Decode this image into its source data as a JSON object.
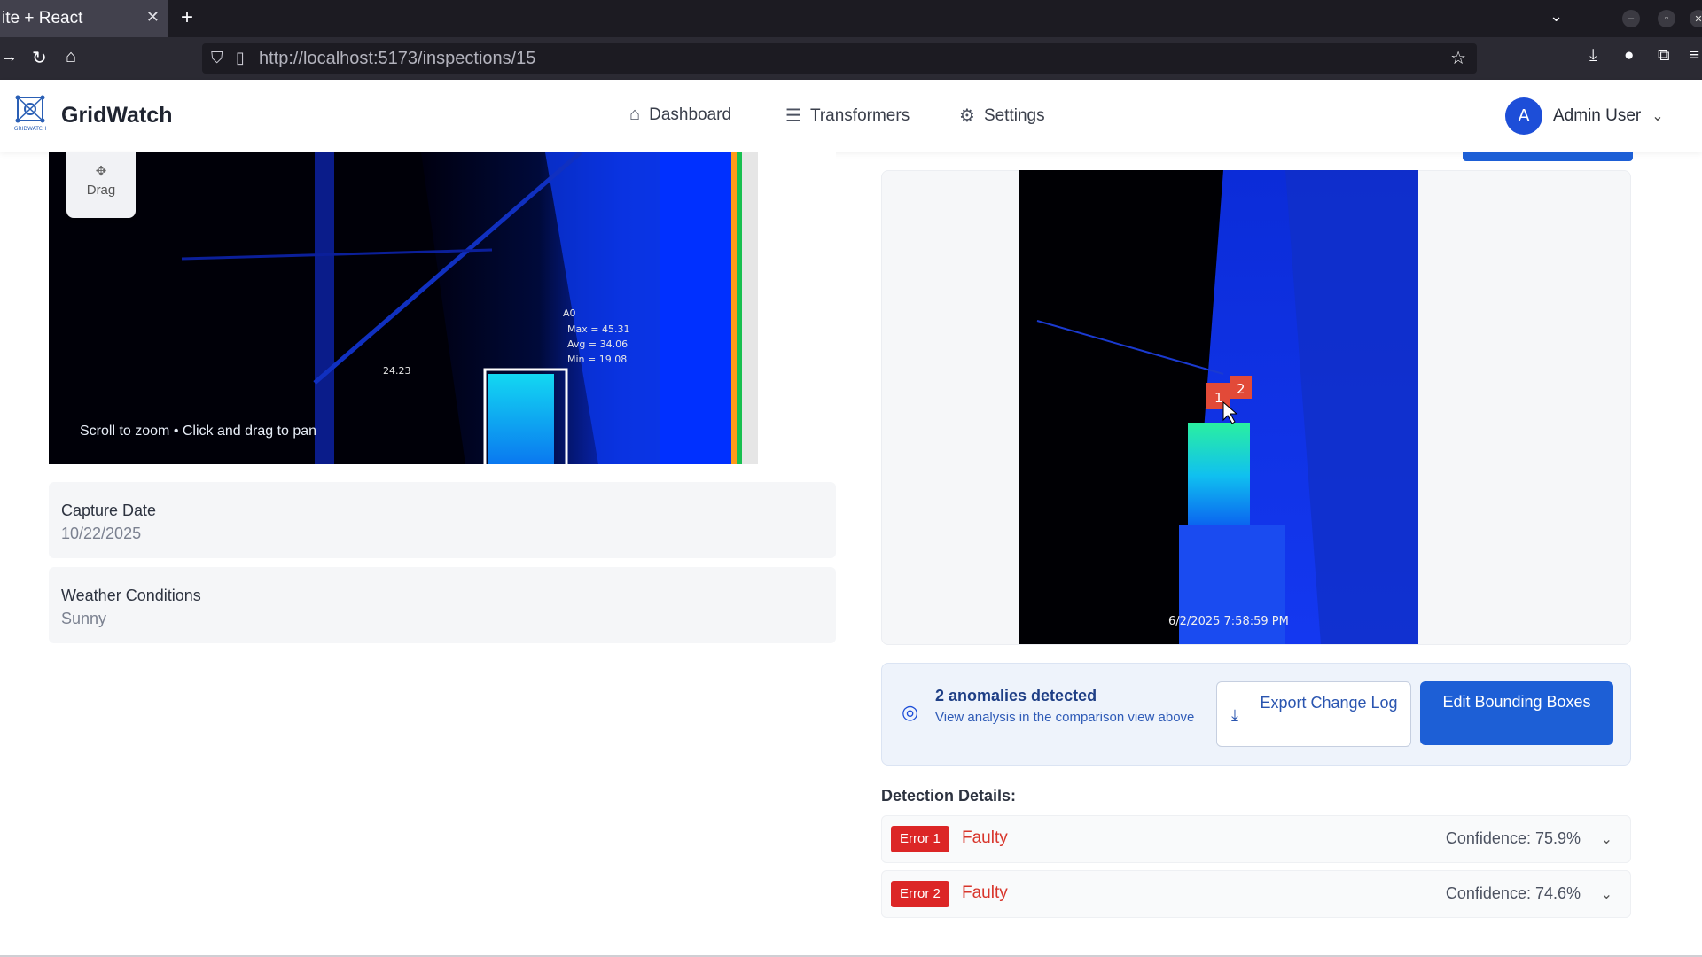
{
  "browser": {
    "tab_title": "ite + React",
    "tab_close": "✕",
    "new_tab": "+",
    "url": "http://localhost:5173/inspections/15"
  },
  "header": {
    "brand": "GridWatch",
    "logo_caption": "GRIDWATCH",
    "nav": [
      {
        "label": "Dashboard",
        "icon": "home-icon"
      },
      {
        "label": "Transformers",
        "icon": "database-icon"
      },
      {
        "label": "Settings",
        "icon": "gear-icon"
      }
    ],
    "user": {
      "initial": "A",
      "name": "Admin User"
    }
  },
  "viewer": {
    "drag_label": "Drag",
    "hint": "Scroll to zoom • Click and drag to pan",
    "thermal_labels": {
      "box_id": "A0",
      "max": "Max = 45.31",
      "avg": "Avg = 34.06",
      "min": "Min = 19.08",
      "point": "24.23"
    }
  },
  "info": {
    "capture_date_label": "Capture Date",
    "capture_date_value": "10/22/2025",
    "weather_label": "Weather Conditions",
    "weather_value": "Sunny"
  },
  "comparison": {
    "timestamp": "6/2/2025 7:58:59 PM",
    "markers": [
      "1",
      "2"
    ]
  },
  "anomalies": {
    "title": "2 anomalies detected",
    "subtitle": "View analysis in the comparison view above",
    "export_label": "Export Change Log",
    "edit_label": "Edit Bounding Boxes"
  },
  "detections": {
    "title": "Detection Details:",
    "items": [
      {
        "badge": "Error 1",
        "kind": "Faulty",
        "confidence": "Confidence: 75.9%"
      },
      {
        "badge": "Error 2",
        "kind": "Faulty",
        "confidence": "Confidence: 74.6%"
      }
    ]
  },
  "colors": {
    "accent": "#1d5fd6",
    "error": "#dc2626",
    "brand_text": "#1f2430"
  }
}
